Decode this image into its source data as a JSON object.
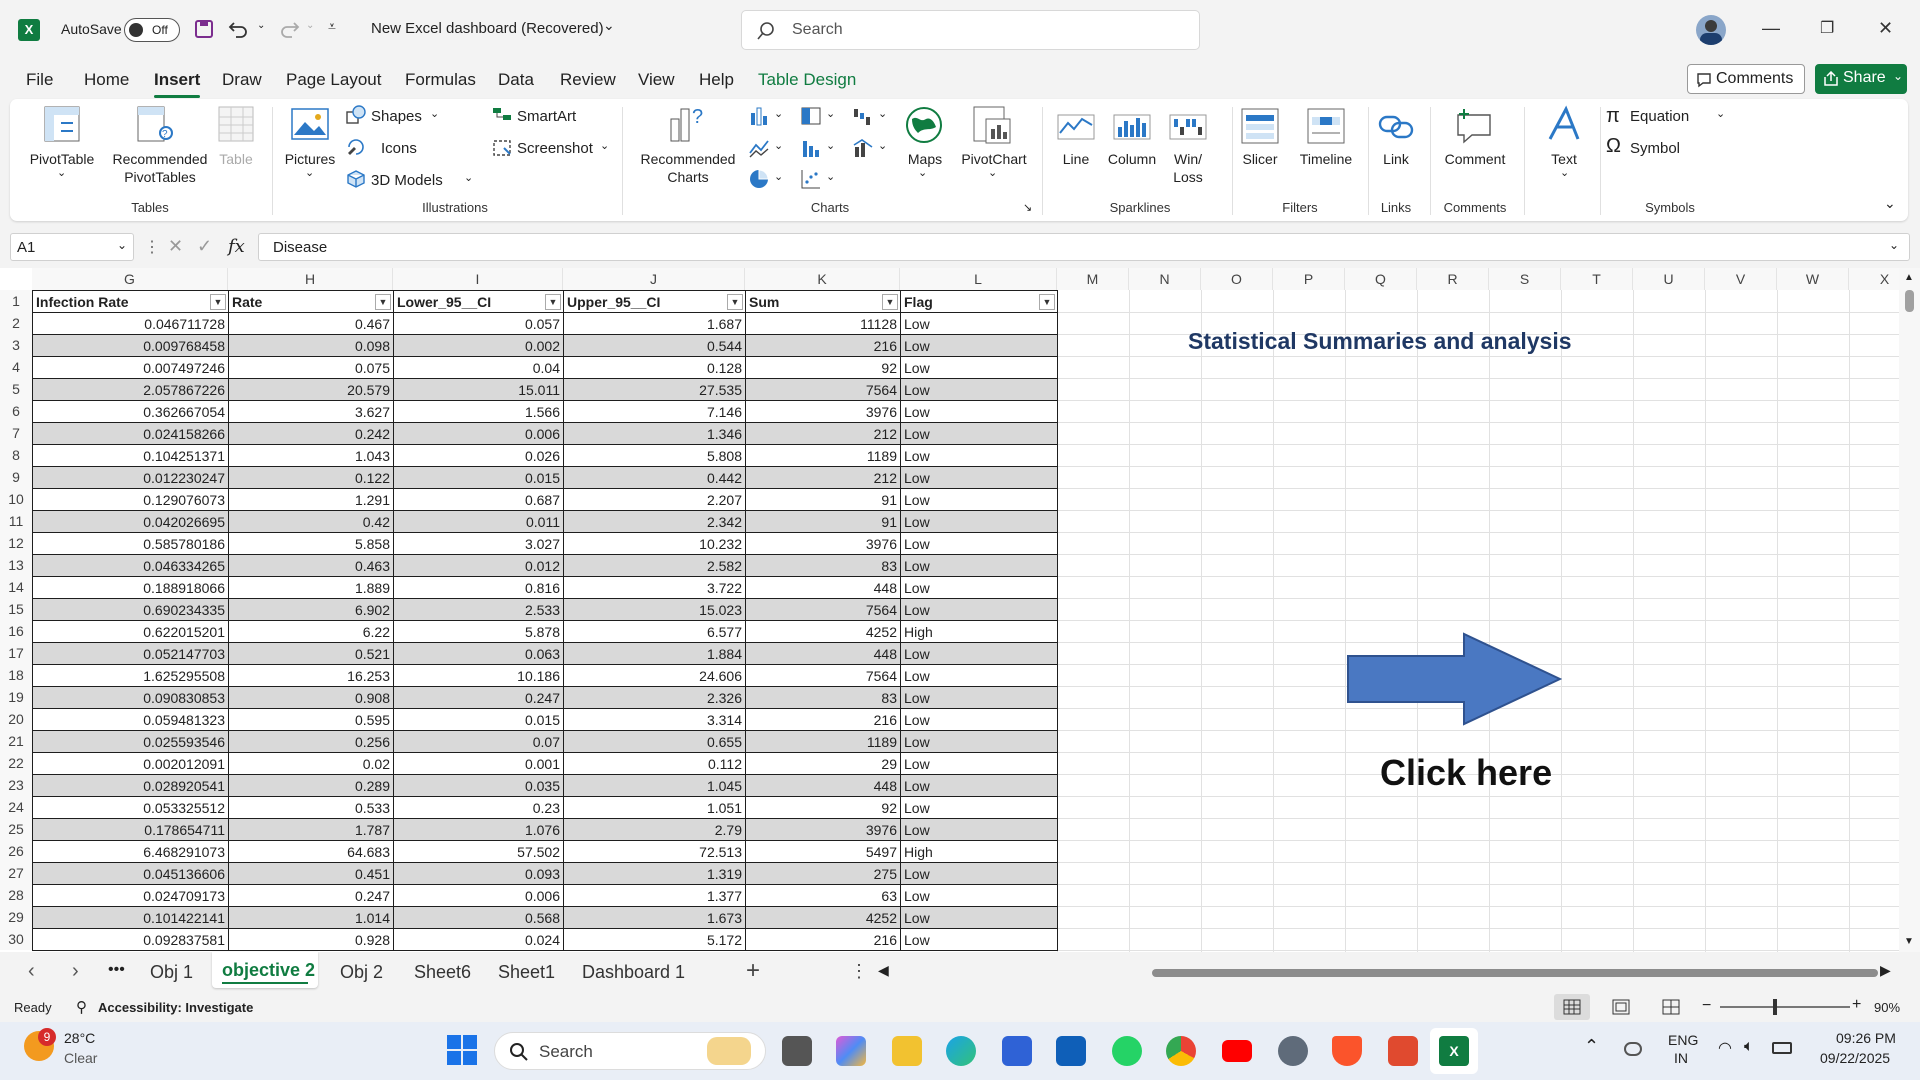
{
  "titlebar": {
    "autosave_label": "AutoSave",
    "autosave_state": "Off",
    "doc_title": "New Excel dashboard (Recovered)",
    "search_placeholder": "Search"
  },
  "menu": [
    "File",
    "Home",
    "Insert",
    "Draw",
    "Page Layout",
    "Formulas",
    "Data",
    "Review",
    "View",
    "Help",
    "Table Design"
  ],
  "active_menu": "Insert",
  "comments_label": "Comments",
  "share_label": "Share",
  "ribbon": {
    "groups": {
      "tables": "Tables",
      "illustrations": "Illustrations",
      "charts": "Charts",
      "sparklines": "Sparklines",
      "filters": "Filters",
      "links": "Links",
      "comments": "Comments",
      "symbols": "Symbols"
    },
    "pivottable": "PivotTable",
    "recommended_pivottables_1": "Recommended",
    "recommended_pivottables_2": "PivotTables",
    "table": "Table",
    "pictures": "Pictures",
    "shapes": "Shapes",
    "icons": "Icons",
    "models3d": "3D Models",
    "smartart": "SmartArt",
    "screenshot": "Screenshot",
    "recommended_charts_1": "Recommended",
    "recommended_charts_2": "Charts",
    "maps": "Maps",
    "pivotchart": "PivotChart",
    "line": "Line",
    "column": "Column",
    "winloss_1": "Win/",
    "winloss_2": "Loss",
    "slicer": "Slicer",
    "timeline": "Timeline",
    "link": "Link",
    "comment": "Comment",
    "text": "Text",
    "equation": "Equation",
    "symbol": "Symbol"
  },
  "formula_bar": {
    "name_box": "A1",
    "fx": "fx",
    "content": "Disease"
  },
  "columns": [
    "G",
    "H",
    "I",
    "J",
    "K",
    "L",
    "M",
    "N",
    "O",
    "P",
    "Q",
    "R",
    "S",
    "T",
    "U",
    "V",
    "W",
    "X"
  ],
  "table_headers": [
    "Infection Rate",
    "Rate",
    "Lower_95__CI",
    "Upper_95__CI",
    "Sum",
    "Flag"
  ],
  "rows": [
    [
      "0.046711728",
      "0.467",
      "0.057",
      "1.687",
      "11128",
      "Low"
    ],
    [
      "0.009768458",
      "0.098",
      "0.002",
      "0.544",
      "216",
      "Low"
    ],
    [
      "0.007497246",
      "0.075",
      "0.04",
      "0.128",
      "92",
      "Low"
    ],
    [
      "2.057867226",
      "20.579",
      "15.011",
      "27.535",
      "7564",
      "Low"
    ],
    [
      "0.362667054",
      "3.627",
      "1.566",
      "7.146",
      "3976",
      "Low"
    ],
    [
      "0.024158266",
      "0.242",
      "0.006",
      "1.346",
      "212",
      "Low"
    ],
    [
      "0.104251371",
      "1.043",
      "0.026",
      "5.808",
      "1189",
      "Low"
    ],
    [
      "0.012230247",
      "0.122",
      "0.015",
      "0.442",
      "212",
      "Low"
    ],
    [
      "0.129076073",
      "1.291",
      "0.687",
      "2.207",
      "91",
      "Low"
    ],
    [
      "0.042026695",
      "0.42",
      "0.011",
      "2.342",
      "91",
      "Low"
    ],
    [
      "0.585780186",
      "5.858",
      "3.027",
      "10.232",
      "3976",
      "Low"
    ],
    [
      "0.046334265",
      "0.463",
      "0.012",
      "2.582",
      "83",
      "Low"
    ],
    [
      "0.188918066",
      "1.889",
      "0.816",
      "3.722",
      "448",
      "Low"
    ],
    [
      "0.690234335",
      "6.902",
      "2.533",
      "15.023",
      "7564",
      "Low"
    ],
    [
      "0.622015201",
      "6.22",
      "5.878",
      "6.577",
      "4252",
      "High"
    ],
    [
      "0.052147703",
      "0.521",
      "0.063",
      "1.884",
      "448",
      "Low"
    ],
    [
      "1.625295508",
      "16.253",
      "10.186",
      "24.606",
      "7564",
      "Low"
    ],
    [
      "0.090830853",
      "0.908",
      "0.247",
      "2.326",
      "83",
      "Low"
    ],
    [
      "0.059481323",
      "0.595",
      "0.015",
      "3.314",
      "216",
      "Low"
    ],
    [
      "0.025593546",
      "0.256",
      "0.07",
      "0.655",
      "1189",
      "Low"
    ],
    [
      "0.002012091",
      "0.02",
      "0.001",
      "0.112",
      "29",
      "Low"
    ],
    [
      "0.028920541",
      "0.289",
      "0.035",
      "1.045",
      "448",
      "Low"
    ],
    [
      "0.053325512",
      "0.533",
      "0.23",
      "1.051",
      "92",
      "Low"
    ],
    [
      "0.178654711",
      "1.787",
      "1.076",
      "2.79",
      "3976",
      "Low"
    ],
    [
      "6.468291073",
      "64.683",
      "57.502",
      "72.513",
      "5497",
      "High"
    ],
    [
      "0.045136606",
      "0.451",
      "0.093",
      "1.319",
      "275",
      "Low"
    ],
    [
      "0.024709173",
      "0.247",
      "0.006",
      "1.377",
      "63",
      "Low"
    ],
    [
      "0.101422141",
      "1.014",
      "0.568",
      "1.673",
      "4252",
      "Low"
    ],
    [
      "0.092837581",
      "0.928",
      "0.024",
      "5.172",
      "216",
      "Low"
    ]
  ],
  "sheet_title": "Statistical Summaries and analysis",
  "click_here": "Click here",
  "sheet_tabs": [
    "Obj 1",
    "objective 2",
    "Obj 2",
    "Sheet6",
    "Sheet1",
    "Dashboard 1"
  ],
  "active_tab": "objective 2",
  "status": {
    "ready": "Ready",
    "accessibility": "Accessibility: Investigate",
    "zoom": "90%"
  },
  "taskbar": {
    "weather_temp": "28°C",
    "weather_desc": "Clear",
    "weather_badge": "9",
    "search": "Search",
    "lang_1": "ENG",
    "lang_2": "IN",
    "time": "09:26 PM",
    "date": "09/22/2025"
  },
  "colors": {
    "excel_green": "#107c41",
    "title_blue": "#1f3864",
    "arrow_fill": "#4a78c2",
    "arrow_stroke": "#2f528f",
    "band_gray": "#d9d9d9"
  }
}
